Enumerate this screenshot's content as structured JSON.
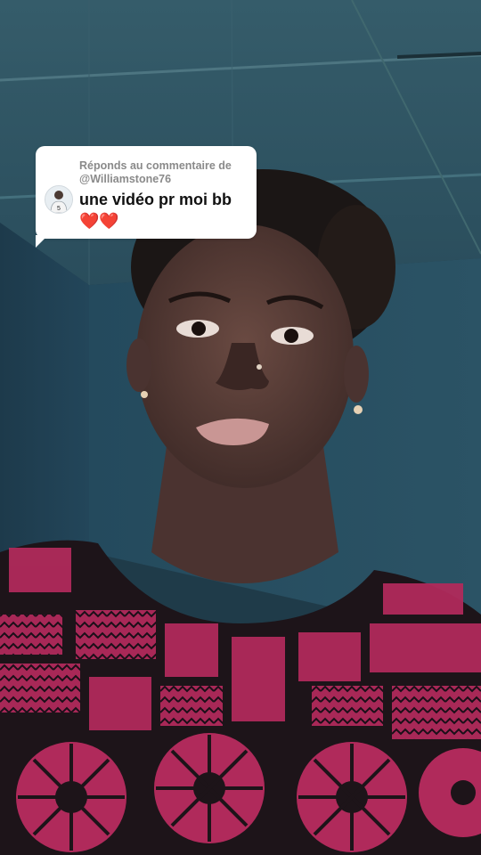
{
  "reply": {
    "header": "Réponds au commentaire de",
    "username": "@Williamstone76",
    "comment": "une vidéo pr moi bb",
    "emoji": "❤️❤️"
  },
  "icons": {
    "avatar": "avatar-photo"
  },
  "colors": {
    "card_bg": "#ffffff",
    "header_text": "#8a8a8a",
    "comment_text": "#111111",
    "wall": "#1f3b49",
    "shirt_pattern": "#b02a5b"
  }
}
